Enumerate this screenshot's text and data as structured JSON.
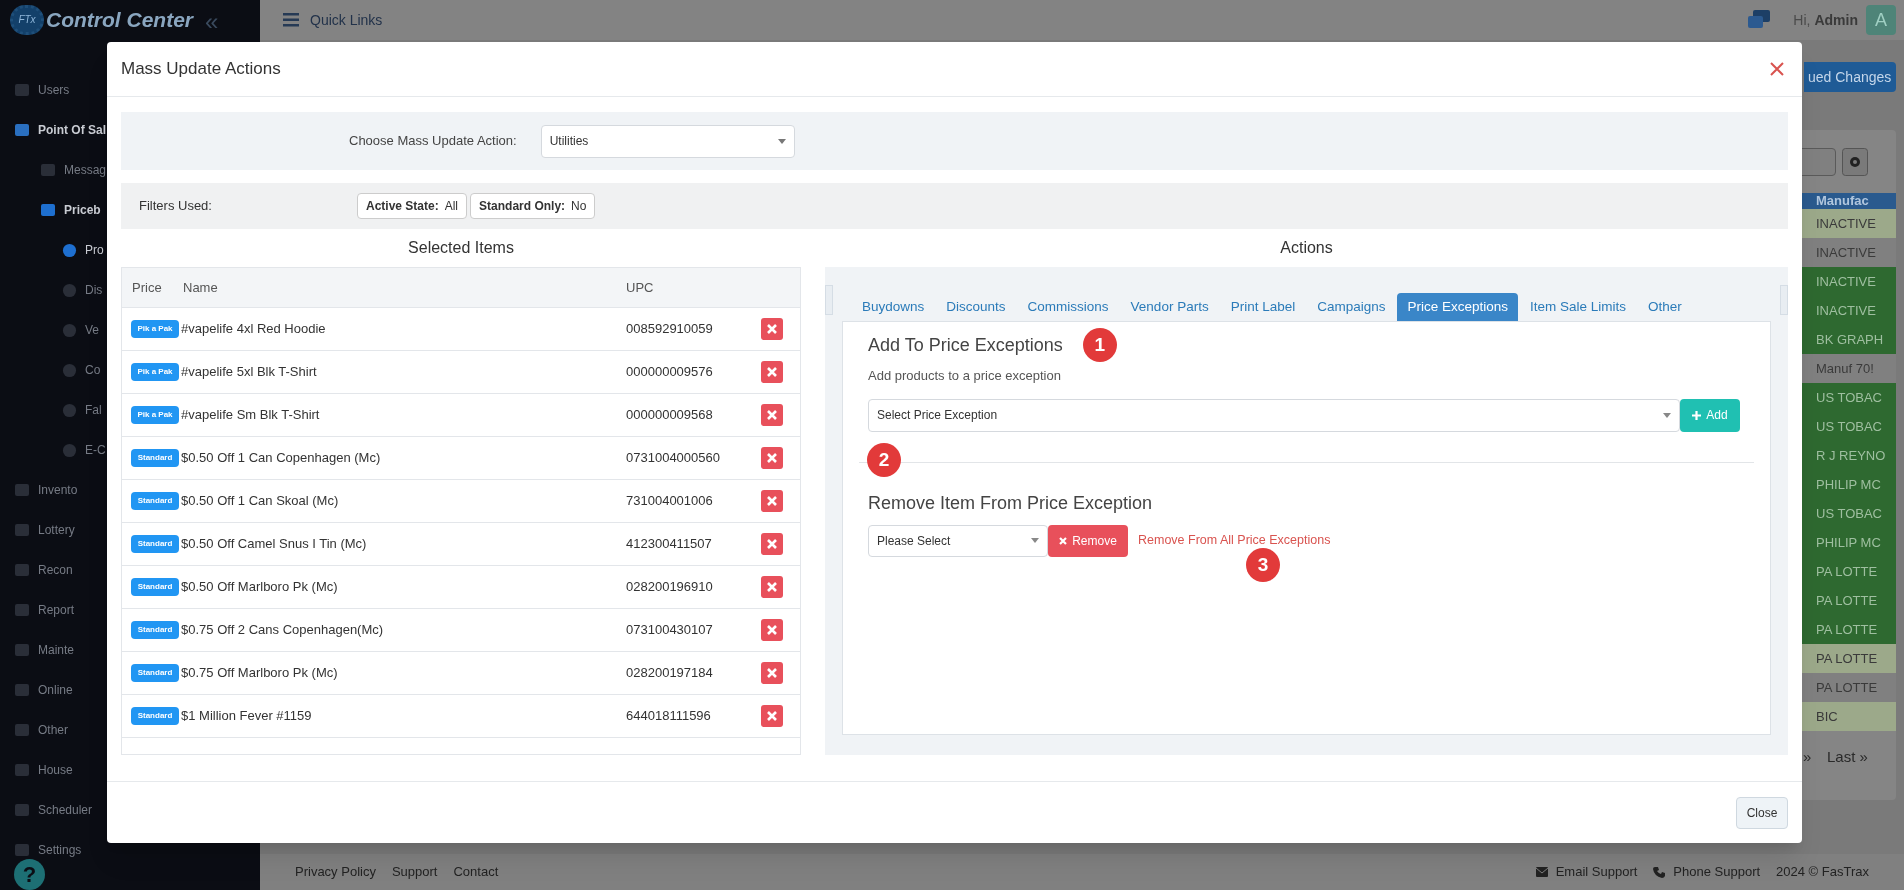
{
  "header": {
    "logo_badge": "FTx",
    "logo_text": "Control Center",
    "collapse": "«",
    "quick_links": "Quick Links",
    "greeting": "Hi,",
    "user": "Admin",
    "avatar": "A"
  },
  "sidebar": {
    "items": [
      {
        "label": "Users",
        "selected": false
      },
      {
        "label": "Point Of Sal",
        "selected": true,
        "children": [
          {
            "label": "Messag",
            "selected": false
          },
          {
            "label": "Priceb",
            "selected": true,
            "children": [
              {
                "label": "Pro",
                "selected": true
              },
              {
                "label": "Dis",
                "selected": false
              },
              {
                "label": "Ve",
                "selected": false
              },
              {
                "label": "Co",
                "selected": false
              },
              {
                "label": "Fal",
                "selected": false
              },
              {
                "label": "E-C",
                "selected": false
              }
            ]
          }
        ]
      },
      {
        "label": "Invento",
        "selected": false
      },
      {
        "label": "Lottery",
        "selected": false
      },
      {
        "label": "Recon",
        "selected": false
      },
      {
        "label": "Report",
        "selected": false
      },
      {
        "label": "Mainte",
        "selected": false
      },
      {
        "label": "Online",
        "selected": false
      },
      {
        "label": "Other",
        "selected": false
      },
      {
        "label": "House",
        "selected": false
      },
      {
        "label": "Scheduler",
        "selected": false
      },
      {
        "label": "Settings",
        "selected": false
      }
    ]
  },
  "background": {
    "queued_button": "ued Changes",
    "table": {
      "column": "Manufac",
      "rows": [
        {
          "text": "INACTIVE",
          "color": "#9ca98a"
        },
        {
          "text": "INACTIVE",
          "color": "#808080"
        },
        {
          "text": "INACTIVE",
          "color": "#2e6930"
        },
        {
          "text": "INACTIVE",
          "color": "#2e6930"
        },
        {
          "text": "BK GRAPH",
          "color": "#2e6930"
        },
        {
          "text": "Manuf 70!",
          "color": "#808080"
        },
        {
          "text": "US TOBAC",
          "color": "#2e6930"
        },
        {
          "text": "US TOBAC",
          "color": "#2e6930"
        },
        {
          "text": "R J REYNO",
          "color": "#2e6930"
        },
        {
          "text": "PHILIP MC",
          "color": "#2e6930"
        },
        {
          "text": "US TOBAC",
          "color": "#2e6930"
        },
        {
          "text": "PHILIP MC",
          "color": "#2e6930"
        },
        {
          "text": "PA LOTTE",
          "color": "#2e6930"
        },
        {
          "text": "PA LOTTE",
          "color": "#2e6930"
        },
        {
          "text": "PA LOTTE",
          "color": "#2e6930"
        },
        {
          "text": "PA LOTTE",
          "color": "#9ca98a"
        },
        {
          "text": "PA LOTTE",
          "color": "#808080"
        },
        {
          "text": "BIC",
          "color": "#9ca98a"
        }
      ]
    },
    "pager_next": "»",
    "pager_last": "Last »"
  },
  "modal": {
    "title": "Mass Update Actions",
    "action_label": "Choose Mass Update Action:",
    "action_value": "Utilities",
    "filters_label": "Filters Used:",
    "filters": [
      {
        "label": "Active State:",
        "value": "All"
      },
      {
        "label": "Standard Only:",
        "value": "No"
      }
    ],
    "selected_title": "Selected Items",
    "columns": [
      "Price",
      "Name",
      "UPC"
    ],
    "items": [
      {
        "price": "Pik a Pak",
        "name": "#vapelife 4xl Red Hoodie",
        "upc": "008592910059"
      },
      {
        "price": "Pik a Pak",
        "name": "#vapelife 5xl Blk T-Shirt",
        "upc": "000000009576"
      },
      {
        "price": "Pik a Pak",
        "name": "#vapelife Sm Blk T-Shirt",
        "upc": "000000009568"
      },
      {
        "price": "Standard",
        "name": "$0.50 Off 1 Can Copenhagen (Mc)",
        "upc": "0731004000560"
      },
      {
        "price": "Standard",
        "name": "$0.50 Off 1 Can Skoal (Mc)",
        "upc": "731004001006"
      },
      {
        "price": "Standard",
        "name": "$0.50 Off Camel Snus I Tin (Mc)",
        "upc": "412300411507"
      },
      {
        "price": "Standard",
        "name": "$0.50 Off Marlboro Pk (Mc)",
        "upc": "028200196910"
      },
      {
        "price": "Standard",
        "name": "$0.75 Off 2 Cans Copenhagen(Mc)",
        "upc": "073100430107"
      },
      {
        "price": "Standard",
        "name": "$0.75 Off Marlboro Pk (Mc)",
        "upc": "028200197184"
      },
      {
        "price": "Standard",
        "name": "$1 Million Fever #1159",
        "upc": "644018111596"
      }
    ],
    "actions_title": "Actions",
    "tabs": [
      {
        "label": "Buydowns",
        "selected": false
      },
      {
        "label": "Discounts",
        "selected": false
      },
      {
        "label": "Commissions",
        "selected": false
      },
      {
        "label": "Vendor Parts",
        "selected": false
      },
      {
        "label": "Print Label",
        "selected": false
      },
      {
        "label": "Campaigns",
        "selected": false
      },
      {
        "label": "Price Exceptions",
        "selected": true
      },
      {
        "label": "Item Sale Limits",
        "selected": false
      },
      {
        "label": "Other",
        "selected": false
      }
    ],
    "add_section": {
      "title": "Add To Price Exceptions",
      "subtitle": "Add products to a price exception",
      "select_placeholder": "Select Price Exception",
      "button": "Add"
    },
    "remove_section": {
      "title": "Remove Item From Price Exception",
      "select_value": "Please Select",
      "button": "Remove",
      "remove_all_link": "Remove From All Price Exceptions"
    },
    "markers": [
      "1",
      "2",
      "3"
    ],
    "close_button": "Close"
  },
  "footer": {
    "links": [
      "Privacy Policy",
      "Support",
      "Contact"
    ],
    "email_support": "Email Support",
    "phone_support": "Phone Support",
    "copyright": "2024 © FasTrax",
    "help": "?"
  }
}
